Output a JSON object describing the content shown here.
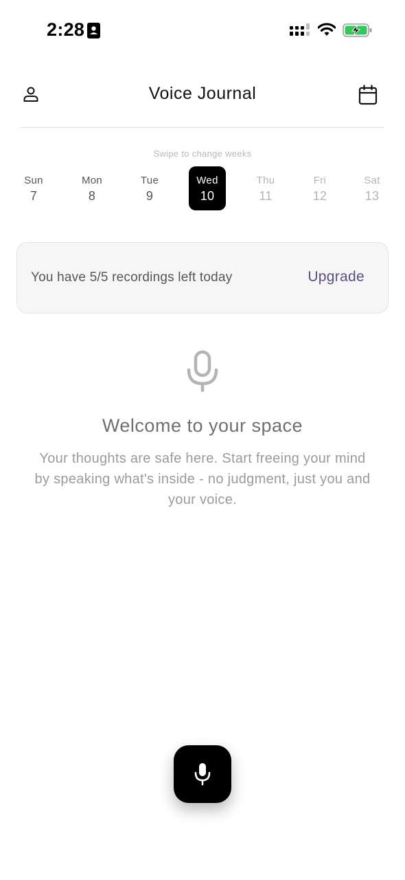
{
  "status_bar": {
    "time": "2:28",
    "icons": [
      "contact-card-icon",
      "cellular-signal-icon",
      "wifi-icon",
      "battery-charging-icon"
    ],
    "battery_color": "#34c759"
  },
  "header": {
    "title": "Voice Journal",
    "left_icon": "person-icon",
    "right_icon": "calendar-icon"
  },
  "week": {
    "hint": "Swipe to change weeks",
    "days": [
      {
        "name": "Sun",
        "num": "7",
        "state": "past"
      },
      {
        "name": "Mon",
        "num": "8",
        "state": "past"
      },
      {
        "name": "Tue",
        "num": "9",
        "state": "past"
      },
      {
        "name": "Wed",
        "num": "10",
        "state": "selected"
      },
      {
        "name": "Thu",
        "num": "11",
        "state": "future"
      },
      {
        "name": "Fri",
        "num": "12",
        "state": "future"
      },
      {
        "name": "Sat",
        "num": "13",
        "state": "future"
      }
    ]
  },
  "quota": {
    "text": "You have 5/5 recordings left today",
    "upgrade_label": "Upgrade",
    "accent_color": "#5c4b85"
  },
  "empty_state": {
    "icon": "microphone-icon",
    "title": "Welcome to your space",
    "body": "Your thoughts are safe here. Start freeing your mind by speaking what's inside - no judgment, just you and your voice."
  },
  "record": {
    "icon": "microphone-icon"
  }
}
